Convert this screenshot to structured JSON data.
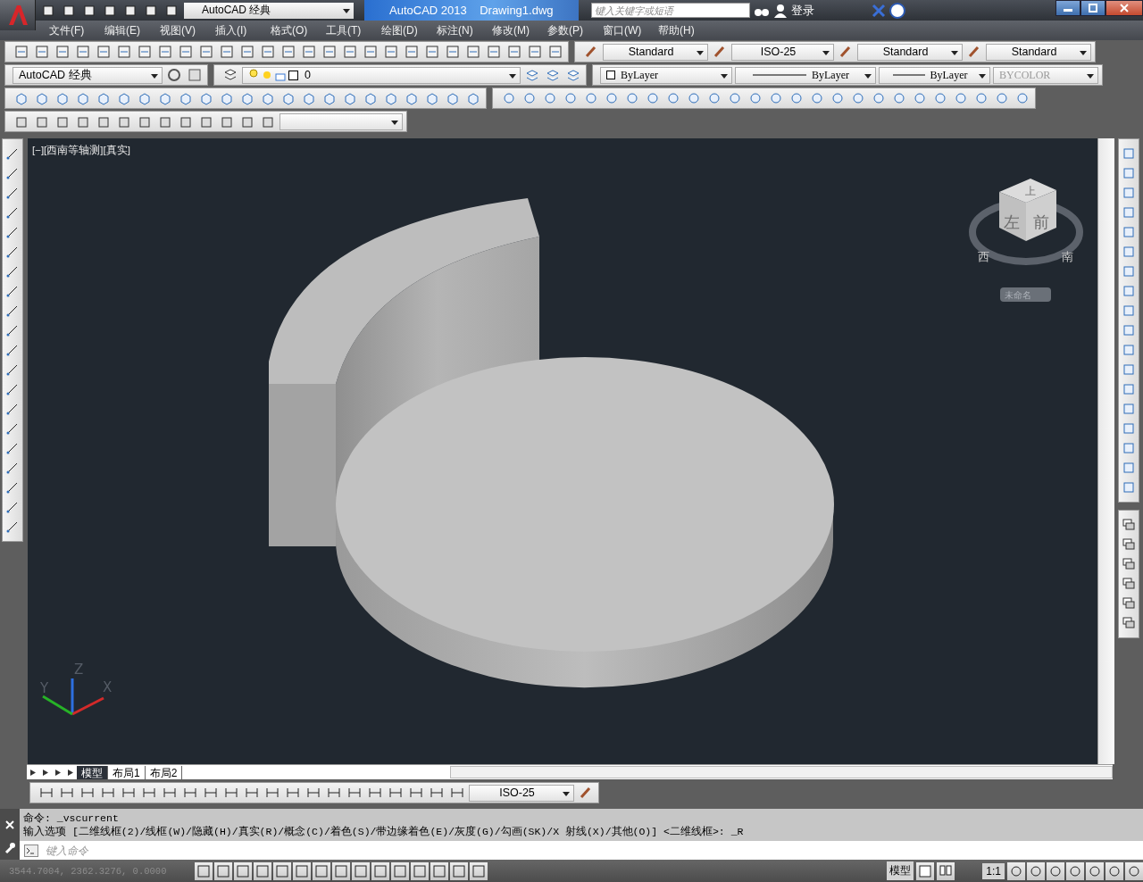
{
  "title_bar": {
    "workspace": "AutoCAD 经典",
    "app_title": "AutoCAD 2013",
    "file_name": "Drawing1.dwg",
    "search": {
      "placeholder": "键入关键字或短语"
    },
    "sign_in": "登录"
  },
  "menu": [
    "文件(F)",
    "编辑(E)",
    "视图(V)",
    "插入(I)",
    "格式(O)",
    "工具(T)",
    "绘图(D)",
    "标注(N)",
    "修改(M)",
    "参数(P)",
    "窗口(W)",
    "帮助(H)"
  ],
  "styles_toolbar": [
    "Standard",
    "ISO-25",
    "Standard",
    "Standard"
  ],
  "workspace_dropdown": "AutoCAD 经典",
  "layer": "0",
  "properties": {
    "color_setting": "ByLayer",
    "linetype": "ByLayer",
    "lineweight": "ByLayer",
    "plot_style": {
      "value": "BYCOLOR",
      "disabled": true
    }
  },
  "viewport": {
    "label": "[−][西南等轴测][真实]",
    "viewcube": {
      "top": "上",
      "left": "左",
      "front": "前",
      "west": "西",
      "south": "南",
      "ucs": "未命名"
    },
    "axes": {
      "x": "X",
      "y": "Y",
      "z": "Z"
    }
  },
  "layout_tabs": [
    {
      "label": "模型",
      "selected": true
    },
    {
      "label": "布局1",
      "selected": false
    },
    {
      "label": "布局2",
      "selected": false
    }
  ],
  "dimension_style": "ISO-25",
  "command": {
    "history": [
      "命令: _vscurrent",
      "输入选项 [二维线框(2)/线框(W)/隐藏(H)/真实(R)/概念(C)/着色(S)/带边缘着色(E)/灰度(G)/勾画(SK)/X 射线(X)/其他(O)] <二维线框>: _R"
    ],
    "placeholder": "键入命令"
  },
  "status_bar": {
    "coordinates": "3544.7004, 2362.3276, 0.0000",
    "model": "模型",
    "scale": "1:1"
  }
}
